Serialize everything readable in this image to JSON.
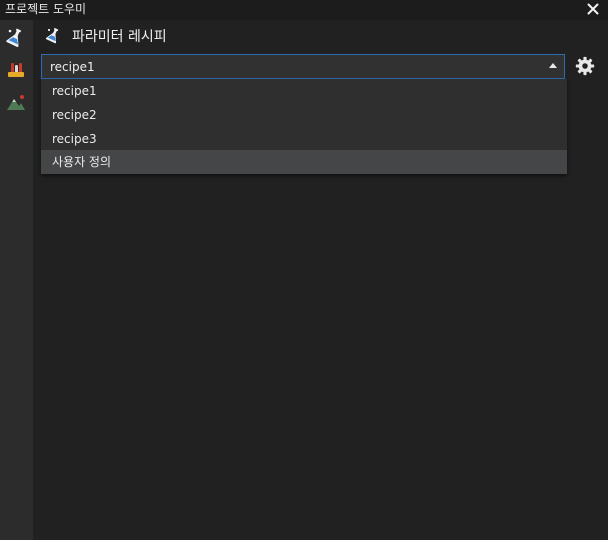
{
  "window": {
    "title": "프로젝트 도우미",
    "close_icon": "close-icon"
  },
  "sidebar": {
    "items": [
      {
        "icon": "flask-icon",
        "active": true
      },
      {
        "icon": "test-tubes-icon",
        "active": false
      },
      {
        "icon": "mountain-icon",
        "active": false
      }
    ]
  },
  "panel": {
    "icon": "flask-icon",
    "title": "파라미터 레시피"
  },
  "recipe_select": {
    "value": "recipe1",
    "options": [
      "recipe1",
      "recipe2",
      "recipe3",
      "사용자 정의"
    ],
    "hovered": "사용자 정의"
  },
  "settings": {
    "icon": "gear-icon"
  },
  "colors": {
    "background": "#212121",
    "sidebar": "#2c2c2c",
    "accent_border": "#2f6bb3",
    "dropdown_bg": "#2f2f2f",
    "hover_bg": "#454648"
  }
}
